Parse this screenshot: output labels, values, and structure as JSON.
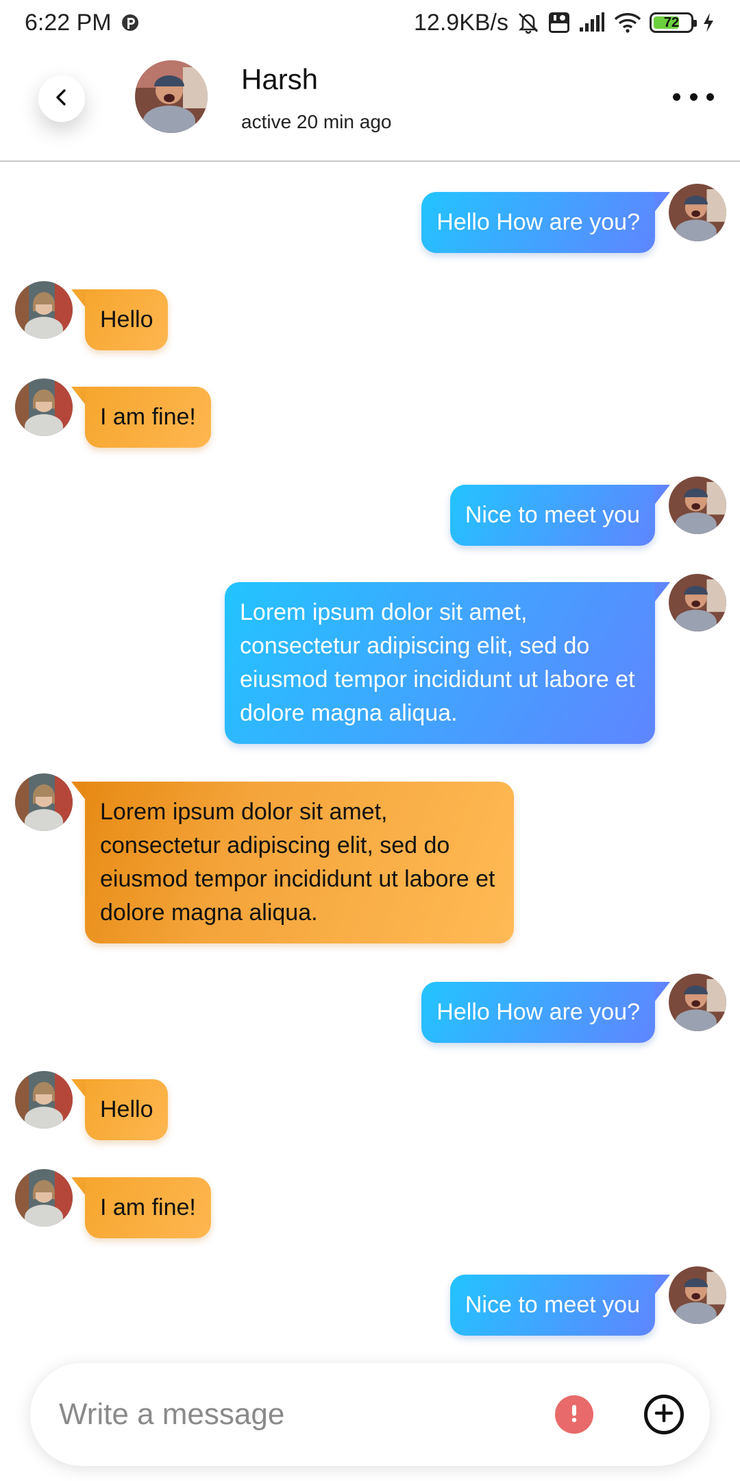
{
  "status_bar": {
    "time": "6:22 PM",
    "net_speed": "12.9KB/s",
    "battery_level": "72",
    "battery_fraction": 0.72,
    "icons": [
      "p-app-icon",
      "mute-icon",
      "volte-icon",
      "signal-icon",
      "wifi-icon",
      "battery-icon",
      "charging-icon"
    ]
  },
  "header": {
    "contact_name": "Harsh",
    "contact_status": "active 20 min ago",
    "icons": [
      "back-chevron-icon",
      "more-dots-icon"
    ]
  },
  "messages": [
    {
      "from": "sent",
      "text": "Hello How are you?"
    },
    {
      "from": "received",
      "text": "Hello"
    },
    {
      "from": "received",
      "text": "I am fine!"
    },
    {
      "from": "sent",
      "text": "Nice to meet you"
    },
    {
      "from": "sent",
      "text": "Lorem ipsum dolor sit amet, consectetur adipiscing elit, sed do eiusmod tempor incididunt ut labore et dolore magna aliqua."
    },
    {
      "from": "received",
      "text": "Lorem ipsum dolor sit amet, consectetur adipiscing elit, sed do eiusmod tempor incididunt ut labore et dolore magna aliqua."
    },
    {
      "from": "sent",
      "text": "Hello How are you?"
    },
    {
      "from": "received",
      "text": "Hello"
    },
    {
      "from": "received",
      "text": "I am fine!"
    },
    {
      "from": "sent",
      "text": "Nice to meet you"
    }
  ],
  "composer": {
    "placeholder": "Write a message",
    "icons": [
      "alert-icon",
      "add-circle-icon"
    ]
  },
  "colors": {
    "sent_gradient_start": "#22c4ff",
    "sent_gradient_end": "#5f85ff",
    "received_gradient_start": "#f5a62e",
    "received_gradient_end": "#ffb650",
    "alert_red": "#e96a6a",
    "battery_green": "#6ccf3e"
  }
}
